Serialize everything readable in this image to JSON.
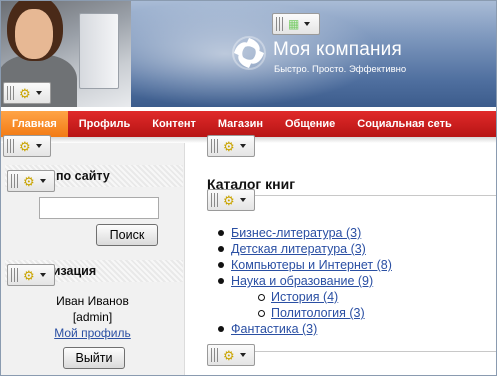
{
  "header": {
    "brand": "Моя компания",
    "slogan": "Быстро. Просто. Эффективно"
  },
  "nav": {
    "items": [
      {
        "label": "Главная",
        "active": true
      },
      {
        "label": "Профиль"
      },
      {
        "label": "Контент"
      },
      {
        "label": "Магазин"
      },
      {
        "label": "Общение"
      },
      {
        "label": "Социальная сеть"
      }
    ]
  },
  "sidebar": {
    "search_title": "Поиск по сайту",
    "search_value": "",
    "search_button": "Поиск",
    "auth_title": "Авторизация",
    "user_name": "Иван Иванов",
    "user_login": "[admin]",
    "profile_link": "Мой профиль",
    "logout_button": "Выйти"
  },
  "main": {
    "title": "Каталог книг",
    "catalog": [
      "Бизнес-литература (3)",
      "Детская литература (3)",
      "Компьютеры и Интернет (8)",
      "Наука и образование (9)"
    ],
    "subcatalog": [
      "История (4)",
      "Политология (3)"
    ],
    "catalog_last": "Фантастика (3)"
  },
  "colors": {
    "nav_red": "#c81c1c",
    "nav_active": "#f58a26",
    "link": "#2a4fa3"
  },
  "icons": [
    "gear-icon",
    "grip-icon",
    "chevron-down-icon",
    "grid-icon",
    "logo-icon"
  ]
}
